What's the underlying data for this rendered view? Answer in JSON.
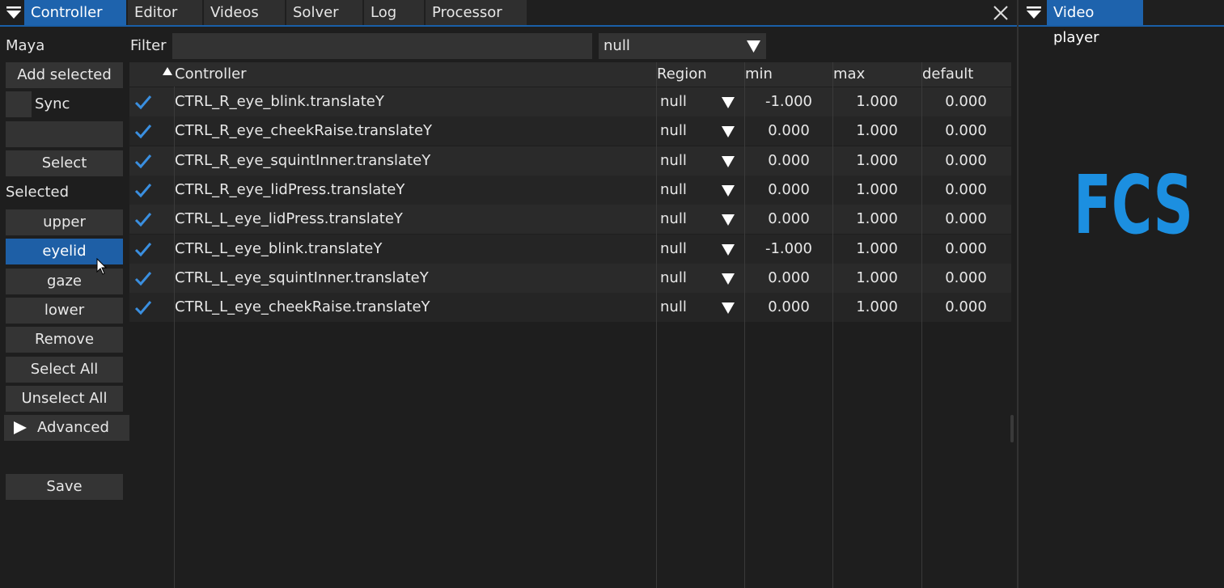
{
  "main_tabs": [
    "Controller",
    "Editor",
    "Videos",
    "Solver",
    "Log",
    "Processor"
  ],
  "video_tab": "Video player",
  "sidebar": {
    "maya_label": "Maya",
    "add_selected": "Add selected",
    "sync_label": "Sync",
    "sync_checked": false,
    "select_button": "Select",
    "selected_label": "Selected",
    "regions": [
      "upper",
      "eyelid",
      "gaze",
      "lower"
    ],
    "active_region": "eyelid",
    "remove": "Remove",
    "select_all": "Select All",
    "unselect_all": "Unselect All",
    "advanced": "Advanced",
    "save": "Save"
  },
  "filter": {
    "label": "Filter",
    "value": "",
    "region_filter": "null"
  },
  "table": {
    "sort_column": "Controller",
    "columns": [
      "Controller",
      "Region",
      "min",
      "max",
      "default"
    ],
    "rows": [
      {
        "checked": true,
        "controller": "CTRL_R_eye_blink.translateY",
        "region": "null",
        "min": "-1.000",
        "max": "1.000",
        "default": "0.000"
      },
      {
        "checked": true,
        "controller": "CTRL_R_eye_cheekRaise.translateY",
        "region": "null",
        "min": "0.000",
        "max": "1.000",
        "default": "0.000"
      },
      {
        "checked": true,
        "controller": "CTRL_R_eye_squintInner.translateY",
        "region": "null",
        "min": "0.000",
        "max": "1.000",
        "default": "0.000"
      },
      {
        "checked": true,
        "controller": "CTRL_R_eye_lidPress.translateY",
        "region": "null",
        "min": "0.000",
        "max": "1.000",
        "default": "0.000"
      },
      {
        "checked": true,
        "controller": "CTRL_L_eye_lidPress.translateY",
        "region": "null",
        "min": "0.000",
        "max": "1.000",
        "default": "0.000"
      },
      {
        "checked": true,
        "controller": "CTRL_L_eye_blink.translateY",
        "region": "null",
        "min": "-1.000",
        "max": "1.000",
        "default": "0.000"
      },
      {
        "checked": true,
        "controller": "CTRL_L_eye_squintInner.translateY",
        "region": "null",
        "min": "0.000",
        "max": "1.000",
        "default": "0.000"
      },
      {
        "checked": true,
        "controller": "CTRL_L_eye_cheekRaise.translateY",
        "region": "null",
        "min": "0.000",
        "max": "1.000",
        "default": "0.000"
      }
    ]
  },
  "logo": {
    "text": "FCS",
    "color": "#1c8fe0"
  },
  "colors": {
    "accent": "#1e63ad",
    "check": "#3a8fe0"
  }
}
